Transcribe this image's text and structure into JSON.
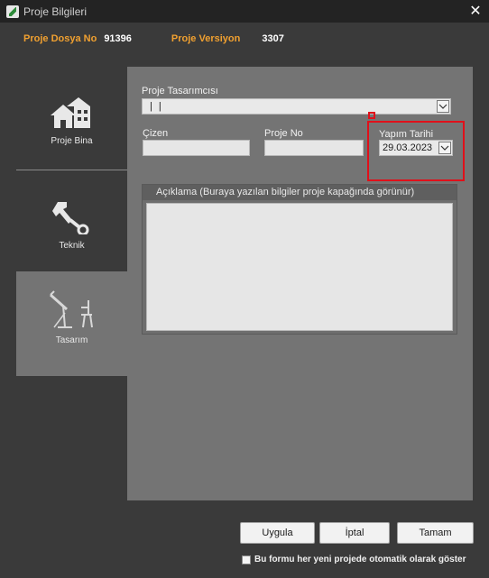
{
  "window": {
    "title": "Proje Bilgileri",
    "close_glyph": "✕"
  },
  "info": {
    "dosya_label": "Proje Dosya No",
    "dosya_value": "91396",
    "versiyon_label": "Proje Versiyon",
    "versiyon_value": "3307"
  },
  "nav": {
    "items": [
      {
        "label": "Proje Bina",
        "icon": "house-icon"
      },
      {
        "label": "Teknik",
        "icon": "wrench-icon"
      },
      {
        "label": "Tasarım",
        "icon": "drafting-table-icon",
        "selected": true
      }
    ]
  },
  "form": {
    "tasarimci_label": "Proje Tasarımcısı",
    "tasarimci_value": "|   |",
    "cizen_label": "Çizen",
    "cizen_value": "",
    "proje_no_label": "Proje No",
    "proje_no_value": "",
    "yapim_tarihi_label": "Yapım Tarihi",
    "yapim_tarihi_value": "29.03.2023",
    "aciklama_label": "Açıklama (Buraya yazılan bilgiler proje kapağında görünür)",
    "aciklama_value": ""
  },
  "buttons": {
    "uygula": "Uygula",
    "iptal": "İptal",
    "tamam": "Tamam"
  },
  "auto_show": {
    "label": "Bu formu her yeni projede otomatik olarak göster",
    "checked": false
  },
  "colors": {
    "accent_orange": "#f0a030",
    "highlight_red": "#e0101a",
    "panel_gray": "#747474",
    "background": "#3a3a3a"
  }
}
